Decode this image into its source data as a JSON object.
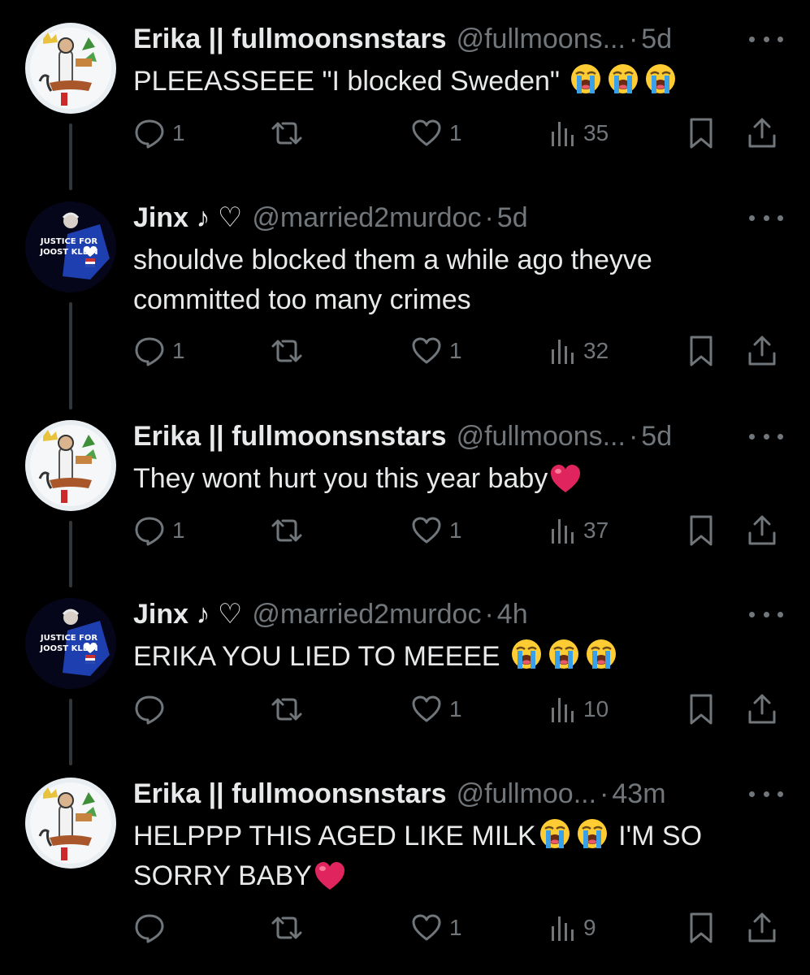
{
  "colors": {
    "background": "#000000",
    "text_primary": "#e7e9ea",
    "text_secondary": "#71767b",
    "thread_line": "#333639",
    "heart_emoji": "#e0245e"
  },
  "tweets": [
    {
      "display_name": "Erika || fullmoonsnstars",
      "handle": "@fullmoons...",
      "separator": "·",
      "time": "5d",
      "avatar": "erika-avatar",
      "segments": [
        {
          "type": "text",
          "text": "PLEEASSEEE \"I blocked Sweden\" "
        },
        {
          "type": "emoji",
          "name": "loudly-crying-face"
        },
        {
          "type": "emoji",
          "name": "loudly-crying-face"
        },
        {
          "type": "emoji",
          "name": "loudly-crying-face"
        }
      ],
      "replies": "1",
      "reposts": "",
      "likes": "1",
      "views": "35"
    },
    {
      "display_name": "Jinx ♪ ♡",
      "handle": "@married2murdoc",
      "separator": "·",
      "time": "5d",
      "avatar": "jinx-avatar",
      "avatar_text_line1": "JUSTICE FOR",
      "avatar_text_line2": "JOOST KLEIN",
      "segments": [
        {
          "type": "text",
          "text": "shouldve blocked them a while ago theyve committed too many crimes"
        }
      ],
      "replies": "1",
      "reposts": "",
      "likes": "1",
      "views": "32"
    },
    {
      "display_name": "Erika || fullmoonsnstars",
      "handle": "@fullmoons...",
      "separator": "·",
      "time": "5d",
      "avatar": "erika-avatar",
      "segments": [
        {
          "type": "text",
          "text": "They wont hurt you this year baby"
        },
        {
          "type": "emoji",
          "name": "red-heart"
        }
      ],
      "replies": "1",
      "reposts": "",
      "likes": "1",
      "views": "37"
    },
    {
      "display_name": "Jinx ♪ ♡",
      "handle": "@married2murdoc",
      "separator": "·",
      "time": "4h",
      "avatar": "jinx-avatar",
      "avatar_text_line1": "JUSTICE FOR",
      "avatar_text_line2": "JOOST KLEIN",
      "segments": [
        {
          "type": "text",
          "text": "ERIKA YOU LIED TO MEEEE "
        },
        {
          "type": "emoji",
          "name": "loudly-crying-face"
        },
        {
          "type": "emoji",
          "name": "loudly-crying-face"
        },
        {
          "type": "emoji",
          "name": "loudly-crying-face"
        }
      ],
      "replies": "",
      "reposts": "",
      "likes": "1",
      "views": "10"
    },
    {
      "display_name": "Erika || fullmoonsnstars",
      "handle": "@fullmoo...",
      "separator": "·",
      "time": "43m",
      "avatar": "erika-avatar",
      "segments": [
        {
          "type": "text",
          "text": "HELPPP THIS AGED LIKE MILK"
        },
        {
          "type": "emoji",
          "name": "loudly-crying-face"
        },
        {
          "type": "emoji",
          "name": "loudly-crying-face"
        },
        {
          "type": "text",
          "text": " I'M SO SORRY BABY"
        },
        {
          "type": "emoji",
          "name": "red-heart"
        }
      ],
      "replies": "",
      "reposts": "",
      "likes": "1",
      "views": "9"
    }
  ]
}
